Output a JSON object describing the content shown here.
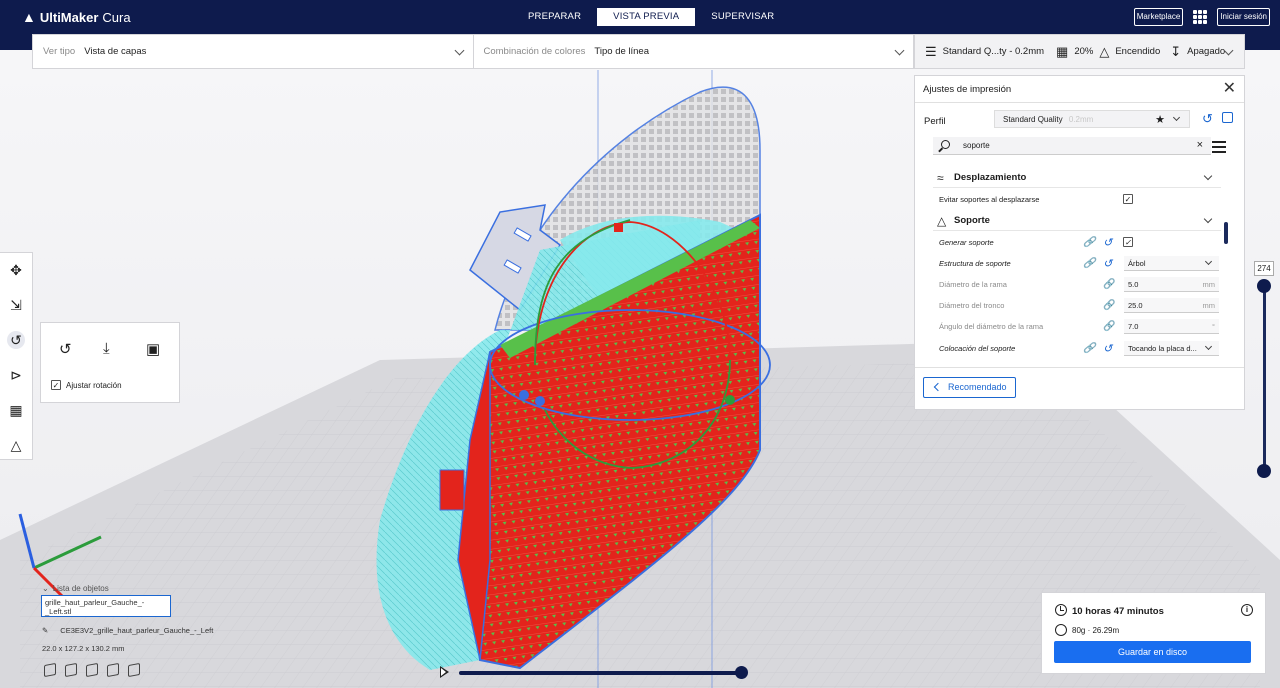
{
  "app": {
    "brand_bold": "UltiMaker",
    "brand_light": "Cura",
    "stages": [
      "PREPARAR",
      "VISTA PREVIA",
      "SUPERVISAR"
    ],
    "active_stage": "VISTA PREVIA",
    "marketplace": "Marketplace",
    "login": "Iniciar sesión"
  },
  "viewbar": {
    "view_type_label": "Ver tipo",
    "view_type_value": "Vista de capas",
    "color_scheme_label": "Combinación de colores",
    "color_scheme_value": "Tipo de línea"
  },
  "print_setup": {
    "profile": "Standard Q...ty - 0.2mm",
    "infill": "20%",
    "support": "Encendido",
    "adhesion": "Apagado"
  },
  "settings_panel": {
    "title": "Ajustes de impresión",
    "profile_label": "Perfil",
    "profile_value": "Standard Quality",
    "profile_sub": "0.2mm",
    "search_value": "soporte",
    "categories": {
      "travel": "Desplazamiento",
      "support": "Soporte"
    },
    "rows": {
      "avoid_supports": "Evitar soportes al desplazarse",
      "generate_support": "Generar soporte",
      "support_structure": "Estructura de soporte",
      "support_structure_value": "Árbol",
      "branch_diameter": "Diámetro de la rama",
      "branch_diameter_value": "5.0",
      "trunk_diameter": "Diámetro del tronco",
      "trunk_diameter_value": "25.0",
      "branch_angle": "Ángulo del diámetro de la rama",
      "branch_angle_value": "7.0",
      "support_placement": "Colocación del soporte",
      "support_placement_value": "Tocando la placa d...",
      "unit_mm": "mm",
      "unit_deg": "°"
    },
    "recommended_button": "Recomendado"
  },
  "rotate_panel": {
    "snap_label": "Ajustar rotación"
  },
  "layer_slider": {
    "value": "274"
  },
  "objects": {
    "header": "Lista de objetos",
    "item": "grille_haut_parleur_Gauche_-_Left.stl",
    "name": "CE3E3V2_grille_haut_parleur_Gauche_-_Left",
    "dims": "22.0 x 127.2 x 130.2 mm"
  },
  "estimate": {
    "time": "10 horas 47 minutos",
    "material": "80g · 26.29m",
    "save_button": "Guardar en disco"
  },
  "colors": {
    "header": "#0e1b4d",
    "accent": "#196ef0",
    "wall": "#e3241c",
    "support": "#66e0e3",
    "infill": "#58c04a"
  }
}
